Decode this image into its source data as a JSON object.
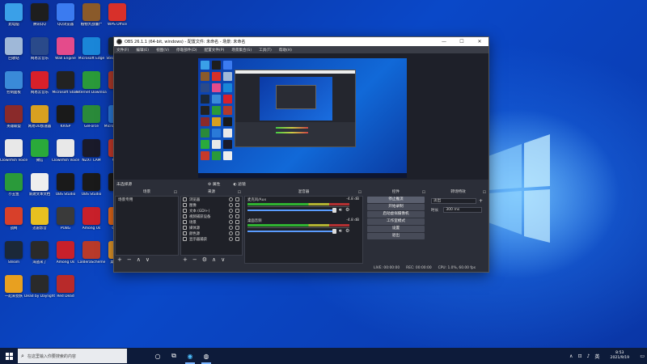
{
  "desktop": {
    "icons": [
      {
        "label": "此电脑",
        "color": "#3aa0e8",
        "icon": "computer-icon"
      },
      {
        "label": "腾讯QQ",
        "color": "#1e1e1e",
        "icon": "qq-icon"
      },
      {
        "label": "QQ浏览器",
        "color": "#3b7bf0",
        "icon": "qq-browser-icon"
      },
      {
        "label": "植物大战僵尸",
        "color": "#8a5a2a",
        "icon": "game-icon"
      },
      {
        "label": "WPS Office",
        "color": "#d8302a",
        "icon": "wps-icon"
      },
      {
        "label": "回收站",
        "color": "#9fb8d8",
        "icon": "recycle-bin-icon"
      },
      {
        "label": "网易云音乐",
        "color": "#2a4a8a",
        "icon": "app-icon"
      },
      {
        "label": "Wall Engine",
        "color": "#e44b8b",
        "icon": "app-icon"
      },
      {
        "label": "Microsoft Edge",
        "color": "#1a86d8",
        "icon": "edge-icon"
      },
      {
        "label": "SteamSetup",
        "color": "#1b2838",
        "icon": "steam-icon"
      },
      {
        "label": "控制面板",
        "color": "#3a8ad8",
        "icon": "control-panel-icon"
      },
      {
        "label": "网易云音乐",
        "color": "#d8202a",
        "icon": "netease-music-icon"
      },
      {
        "label": "Microsoft Store",
        "color": "#222",
        "icon": "store-icon"
      },
      {
        "label": "Internet Download",
        "color": "#2a9a3a",
        "icon": "download-icon"
      },
      {
        "label": "LOL",
        "color": "#b23a2a",
        "icon": "game-icon"
      },
      {
        "label": "英雄联盟",
        "color": "#8a2a2a",
        "icon": "game-icon"
      },
      {
        "label": "网易UU加速器",
        "color": "#d8a020",
        "icon": "app-icon"
      },
      {
        "label": "KRISP",
        "color": "#1a1a1a",
        "icon": "app-icon"
      },
      {
        "label": "GeForce",
        "color": "#2a8a3a",
        "icon": "nvidia-icon"
      },
      {
        "label": "Microsoft Edge",
        "color": "#2a7ad8",
        "icon": "edge-icon"
      },
      {
        "label": "Clownfish Voice",
        "color": "#e8e8e8",
        "icon": "document-icon"
      },
      {
        "label": "微信",
        "color": "#2aaa3a",
        "icon": "wechat-icon"
      },
      {
        "label": "Clownfish Voice",
        "color": "#e8e8e8",
        "icon": "document-icon"
      },
      {
        "label": "NZXT CAM",
        "color": "#1a1a2a",
        "icon": "app-icon"
      },
      {
        "label": "Clash",
        "color": "#c83a2a",
        "icon": "app-icon"
      },
      {
        "label": "小丑鱼",
        "color": "#2a9a3a",
        "icon": "app-icon"
      },
      {
        "label": "新建文本文档",
        "color": "#eeeeee",
        "icon": "document-icon"
      },
      {
        "label": "OBS Studio",
        "color": "#1a1a1a",
        "icon": "obs-icon"
      },
      {
        "label": "OBS Studio",
        "color": "#1a1a1a",
        "icon": "obs-icon"
      },
      {
        "label": "QQ",
        "color": "#1a1a1a",
        "icon": "qq-icon"
      },
      {
        "label": "战网",
        "color": "#d8402a",
        "icon": "app-icon"
      },
      {
        "label": "迅雷影音",
        "color": "#e8c020",
        "icon": "app-icon"
      },
      {
        "label": "PUBG",
        "color": "#3a3a3a",
        "icon": "game-icon"
      },
      {
        "label": "Among Us",
        "color": "#c8202a",
        "icon": "game-icon"
      },
      {
        "label": "Origin",
        "color": "#e86a1a",
        "icon": "origin-icon"
      },
      {
        "label": "Steam",
        "color": "#1b2838",
        "icon": "steam-icon"
      },
      {
        "label": "海盗来了",
        "color": "#2a2a2a",
        "icon": "game-icon"
      },
      {
        "label": "Among Us",
        "color": "#c8202a",
        "icon": "game-icon"
      },
      {
        "label": "CalderaScheme",
        "color": "#b83a2a",
        "icon": "game-icon"
      },
      {
        "label": "桌面工具",
        "color": "#e89a2a",
        "icon": "app-icon"
      },
      {
        "label": "一起来捉妖",
        "color": "#e8a020",
        "icon": "game-icon"
      },
      {
        "label": "Dead by Daylight",
        "color": "#2a2a2a",
        "icon": "game-icon"
      },
      {
        "label": "Red Dead",
        "color": "#b82a2a",
        "icon": "game-icon"
      }
    ]
  },
  "obs": {
    "title": "OBS 26.1.1 (64-bit, windows) - 配置文件: 未命名 - 场景: 未命名",
    "menu": [
      "文件(F)",
      "编辑(E)",
      "视图(V)",
      "停靠部件(D)",
      "配置文件(P)",
      "场景集合(S)",
      "工具(T)",
      "帮助(H)"
    ],
    "scene_bar": {
      "label": "未选择源",
      "props": "属性",
      "filters": "滤镜"
    },
    "docks": {
      "scenes": {
        "title": "场景",
        "items": [
          "场景专用"
        ]
      },
      "sources": {
        "title": "来源",
        "items": [
          "浏览器",
          "图像",
          "文本 (GDI+)",
          "视频捕获设备",
          "场景",
          "媒体源",
          "颜色源",
          "显示器捕获"
        ]
      },
      "mixer": {
        "title": "混音器",
        "channels": [
          {
            "name": "麦克风/Aux",
            "db": "-4.8 dB"
          },
          {
            "name": "桌面音频",
            "db": "-4.8 dB"
          }
        ]
      },
      "controls": {
        "title": "控件",
        "buttons": [
          "停止推流",
          "开始录制",
          "启动虚拟摄像机",
          "工作室模式",
          "设置",
          "退出"
        ]
      },
      "transitions": {
        "title": "转场特效",
        "type": "淡出",
        "duration_label": "时长",
        "duration_value": "300 ms"
      }
    },
    "status": {
      "live": "LIVE: 00:00:00",
      "rec": "REC: 00:00:00",
      "cpu": "CPU: 1.0%, 60.00 fps"
    }
  },
  "taskbar": {
    "search_placeholder": "在这里输入你要搜索的内容",
    "time": "8:53",
    "date": "2021/9/19"
  }
}
